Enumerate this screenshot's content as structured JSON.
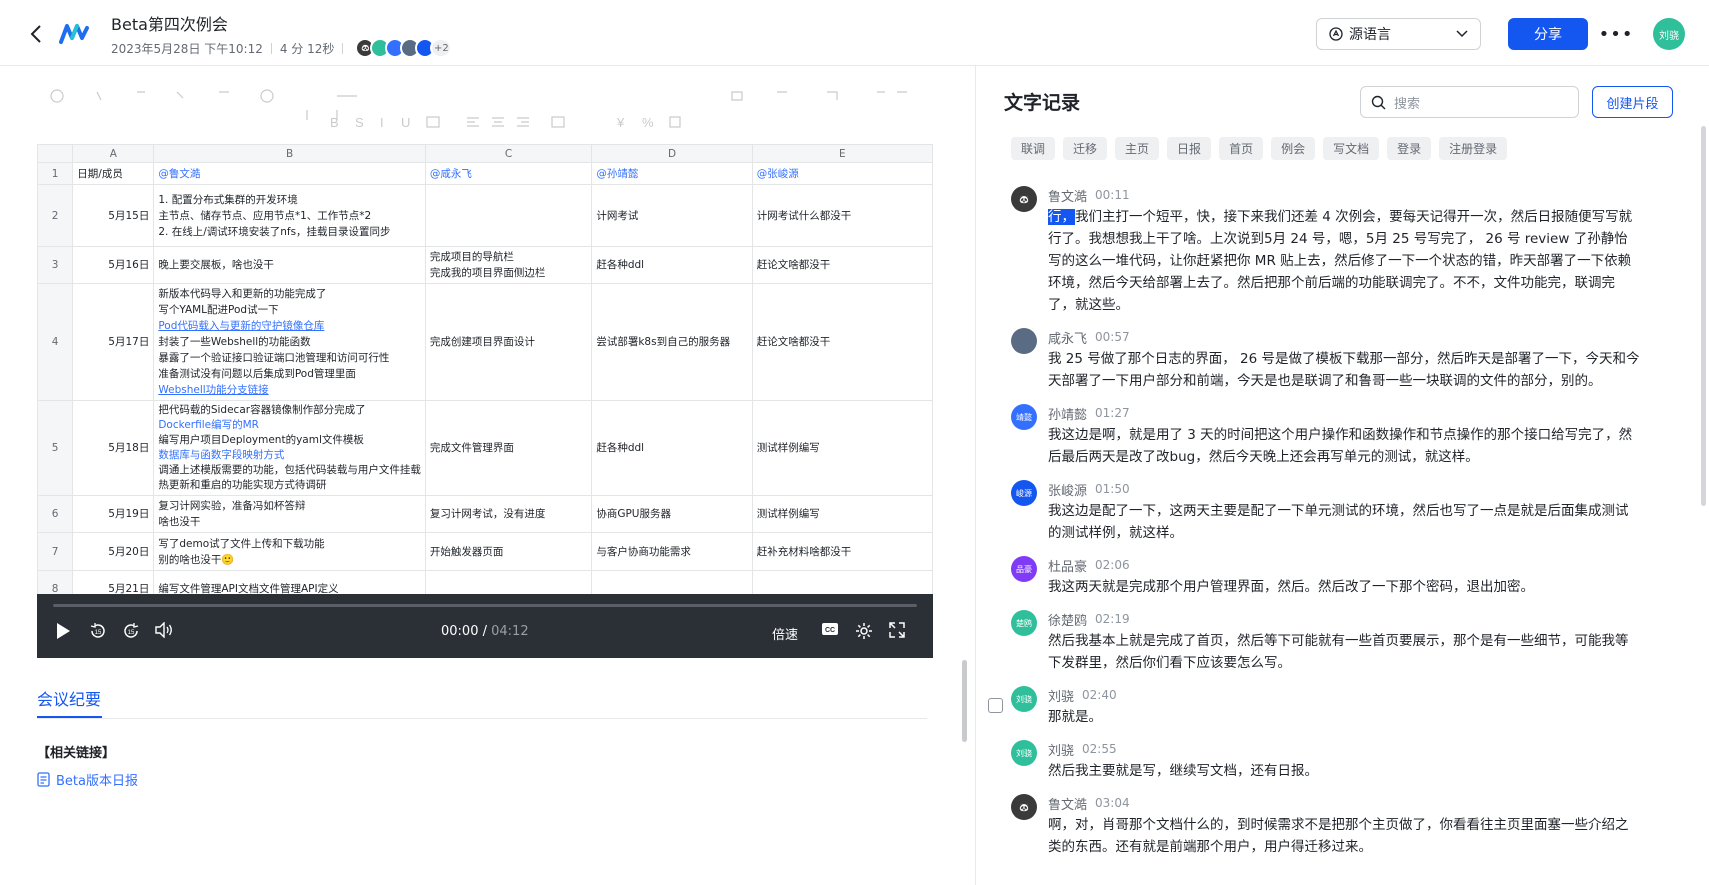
{
  "header": {
    "title": "Beta第四次例会",
    "date": "2023年5月28日 下午10:12",
    "duration": "4 分 12秒",
    "participants_more": "+2",
    "lang_select": "源语言",
    "share_label": "分享",
    "user_avatar": "刘骁"
  },
  "sheet": {
    "columns": [
      "A",
      "B",
      "C",
      "D",
      "E"
    ],
    "header_row": {
      "rn": "1",
      "a": "日期/成员",
      "b": "@鲁文澔",
      "c": "@咸永飞",
      "d": "@孙靖懿",
      "e": "@张峻源"
    },
    "rows": [
      {
        "rn": "2",
        "date": "5月15日",
        "b": [
          "1. 配置分布式集群的开发环境",
          "主节点、储存节点、应用节点*1、工作节点*2",
          "2. 在线上/调试环境安装了nfs，挂载目录设置同步"
        ],
        "c": "",
        "d": "计网考试",
        "e": "计网考试什么都没干"
      },
      {
        "rn": "3",
        "date": "5月16日",
        "b": [
          "晚上要交展板，啥也没干"
        ],
        "c": "完成项目的导航栏\n完成我的项目界面侧边栏",
        "d": "赶各种ddl",
        "e": "赶论文啥都没干"
      },
      {
        "rn": "4",
        "date": "5月17日",
        "b": [
          "新版本代码导入和更新的功能完成了",
          "写个YAML配进Pod试一下",
          "Pod代码载入与更新的守护镜像仓库",
          "封装了一些Webshell的功能函数",
          "暴露了一个验证接口验证端口池管理和访问可行性",
          "准备测试没有问题以后集成到Pod管理里面",
          "Webshell功能分支链接"
        ],
        "c": "完成创建项目界面设计",
        "d": "尝试部署k8s到自己的服务器",
        "e": "赶论文啥都没干"
      },
      {
        "rn": "5",
        "date": "5月18日",
        "b": [
          "把代码载的Sidecar容器镜像制作部分完成了",
          "Dockerfile编写的MR",
          "编写用户项目Deployment的yaml文件模板",
          "数据库与函数字段映射方式",
          "调通上述模版需要的功能，包括代码装载与用户文件挂载",
          "热更新和重启的功能实现方式待调研"
        ],
        "c": "完成文件管理界面",
        "d": "赶各种ddl",
        "e": "测试样例编写"
      },
      {
        "rn": "6",
        "date": "5月19日",
        "b": [
          "复习计网实验，准备冯如杯答辩",
          "啥也没干"
        ],
        "c": "复习计网考试，没有进度",
        "d": "协商GPU服务器",
        "e": "测试样例编写"
      },
      {
        "rn": "7",
        "date": "5月20日",
        "b": [
          "写了demo试了文件上传和下载功能",
          "别的啥也没干🙂"
        ],
        "c": "开始触发器页面",
        "d": "与客户协商功能需求",
        "e": "赶补充材料啥都没干"
      },
      {
        "rn": "8",
        "date": "5月21日",
        "b": [
          "编写文件管理API文档文件管理API定义"
        ],
        "c": "",
        "d": "",
        "e": ""
      }
    ]
  },
  "player": {
    "current": "00:00",
    "total": "04:12",
    "speed_label": "倍速",
    "cc_label": "CC"
  },
  "summary": {
    "tab_label": "会议纪要",
    "related_title": "【相关链接】",
    "doc_link": "Beta版本日报"
  },
  "transcript": {
    "title": "文字记录",
    "search_placeholder": "搜索",
    "clip_label": "创建片段",
    "tags": [
      "联调",
      "迁移",
      "主页",
      "日报",
      "首页",
      "例会",
      "写文档",
      "登录",
      "注册登录"
    ],
    "entries": [
      {
        "name": "鲁文澔",
        "time": "00:11",
        "avatar": "",
        "color": "#3a3a3a",
        "highlight": "行，",
        "text": "我们主打一个短平，快，接下来我们还差 4 次例会，要每天记得开一次，然后日报随便写写就行了。我想想我上干了啥。上次说到5月 24 号，嗯，5月 25 号写完了， 26 号 review 了孙静怡写的这么一堆代码，让你赶紧把你 MR 贴上去，然后修了一下一个状态的错，昨天部署了一下依赖环境，然后今天给部署上去了。然后把那个前后端的功能联调完了。不不，文件功能完，联调完了，就这些。"
      },
      {
        "name": "咸永飞",
        "time": "00:57",
        "avatar": "",
        "color": "#5a6b84",
        "highlight": "",
        "text": "我 25 号做了那个日志的界面， 26 号是做了模板下载那一部分，然后昨天是部署了一下，今天和今天部署了一下用户部分和前端，今天是也是联调了和鲁哥一些一块联调的文件的部分，别的。"
      },
      {
        "name": "孙靖懿",
        "time": "01:27",
        "avatar": "靖懿",
        "color": "#3370ff",
        "highlight": "",
        "text": "我这边是啊，就是用了 3 天的时间把这个用户操作和函数操作和节点操作的那个接口给写完了，然后最后两天是改了改bug，然后今天晚上还会再写单元的测试，就这样。"
      },
      {
        "name": "张峻源",
        "time": "01:50",
        "avatar": "峻源",
        "color": "#1456f0",
        "highlight": "",
        "text": "我这边是配了一下，这两天主要是配了一下单元测试的环境，然后也写了一点是就是后面集成测试的测试样例，就这样。"
      },
      {
        "name": "杜品豪",
        "time": "02:06",
        "avatar": "品豪",
        "color": "#7f3bf5",
        "highlight": "",
        "text": "我这两天就是完成那个用户管理界面，然后。然后改了一下那个密码，退出加密。"
      },
      {
        "name": "徐楚鸥",
        "time": "02:19",
        "avatar": "楚鸥",
        "color": "#2fbf9a",
        "highlight": "",
        "text": "然后我基本上就是完成了首页，然后等下可能就有一些首页要展示，那个是有一些细节，可能我等下发群里，然后你们看下应该要怎么写。"
      },
      {
        "name": "刘骁",
        "time": "02:40",
        "avatar": "刘骁",
        "color": "#2fbf9a",
        "highlight": "",
        "text": "那就是。"
      },
      {
        "name": "刘骁",
        "time": "02:55",
        "avatar": "刘骁",
        "color": "#2fbf9a",
        "highlight": "",
        "text": "然后我主要就是写，继续写文档，还有日报。"
      },
      {
        "name": "鲁文澔",
        "time": "03:04",
        "avatar": "",
        "color": "#3a3a3a",
        "highlight": "",
        "text": "啊，对，肖哥那个文档什么的，到时候需求不是把那个主页做了，你看看往主页里面塞一些介绍之类的东西。还有就是前端那个用户，用户得迁移过来。"
      }
    ]
  }
}
